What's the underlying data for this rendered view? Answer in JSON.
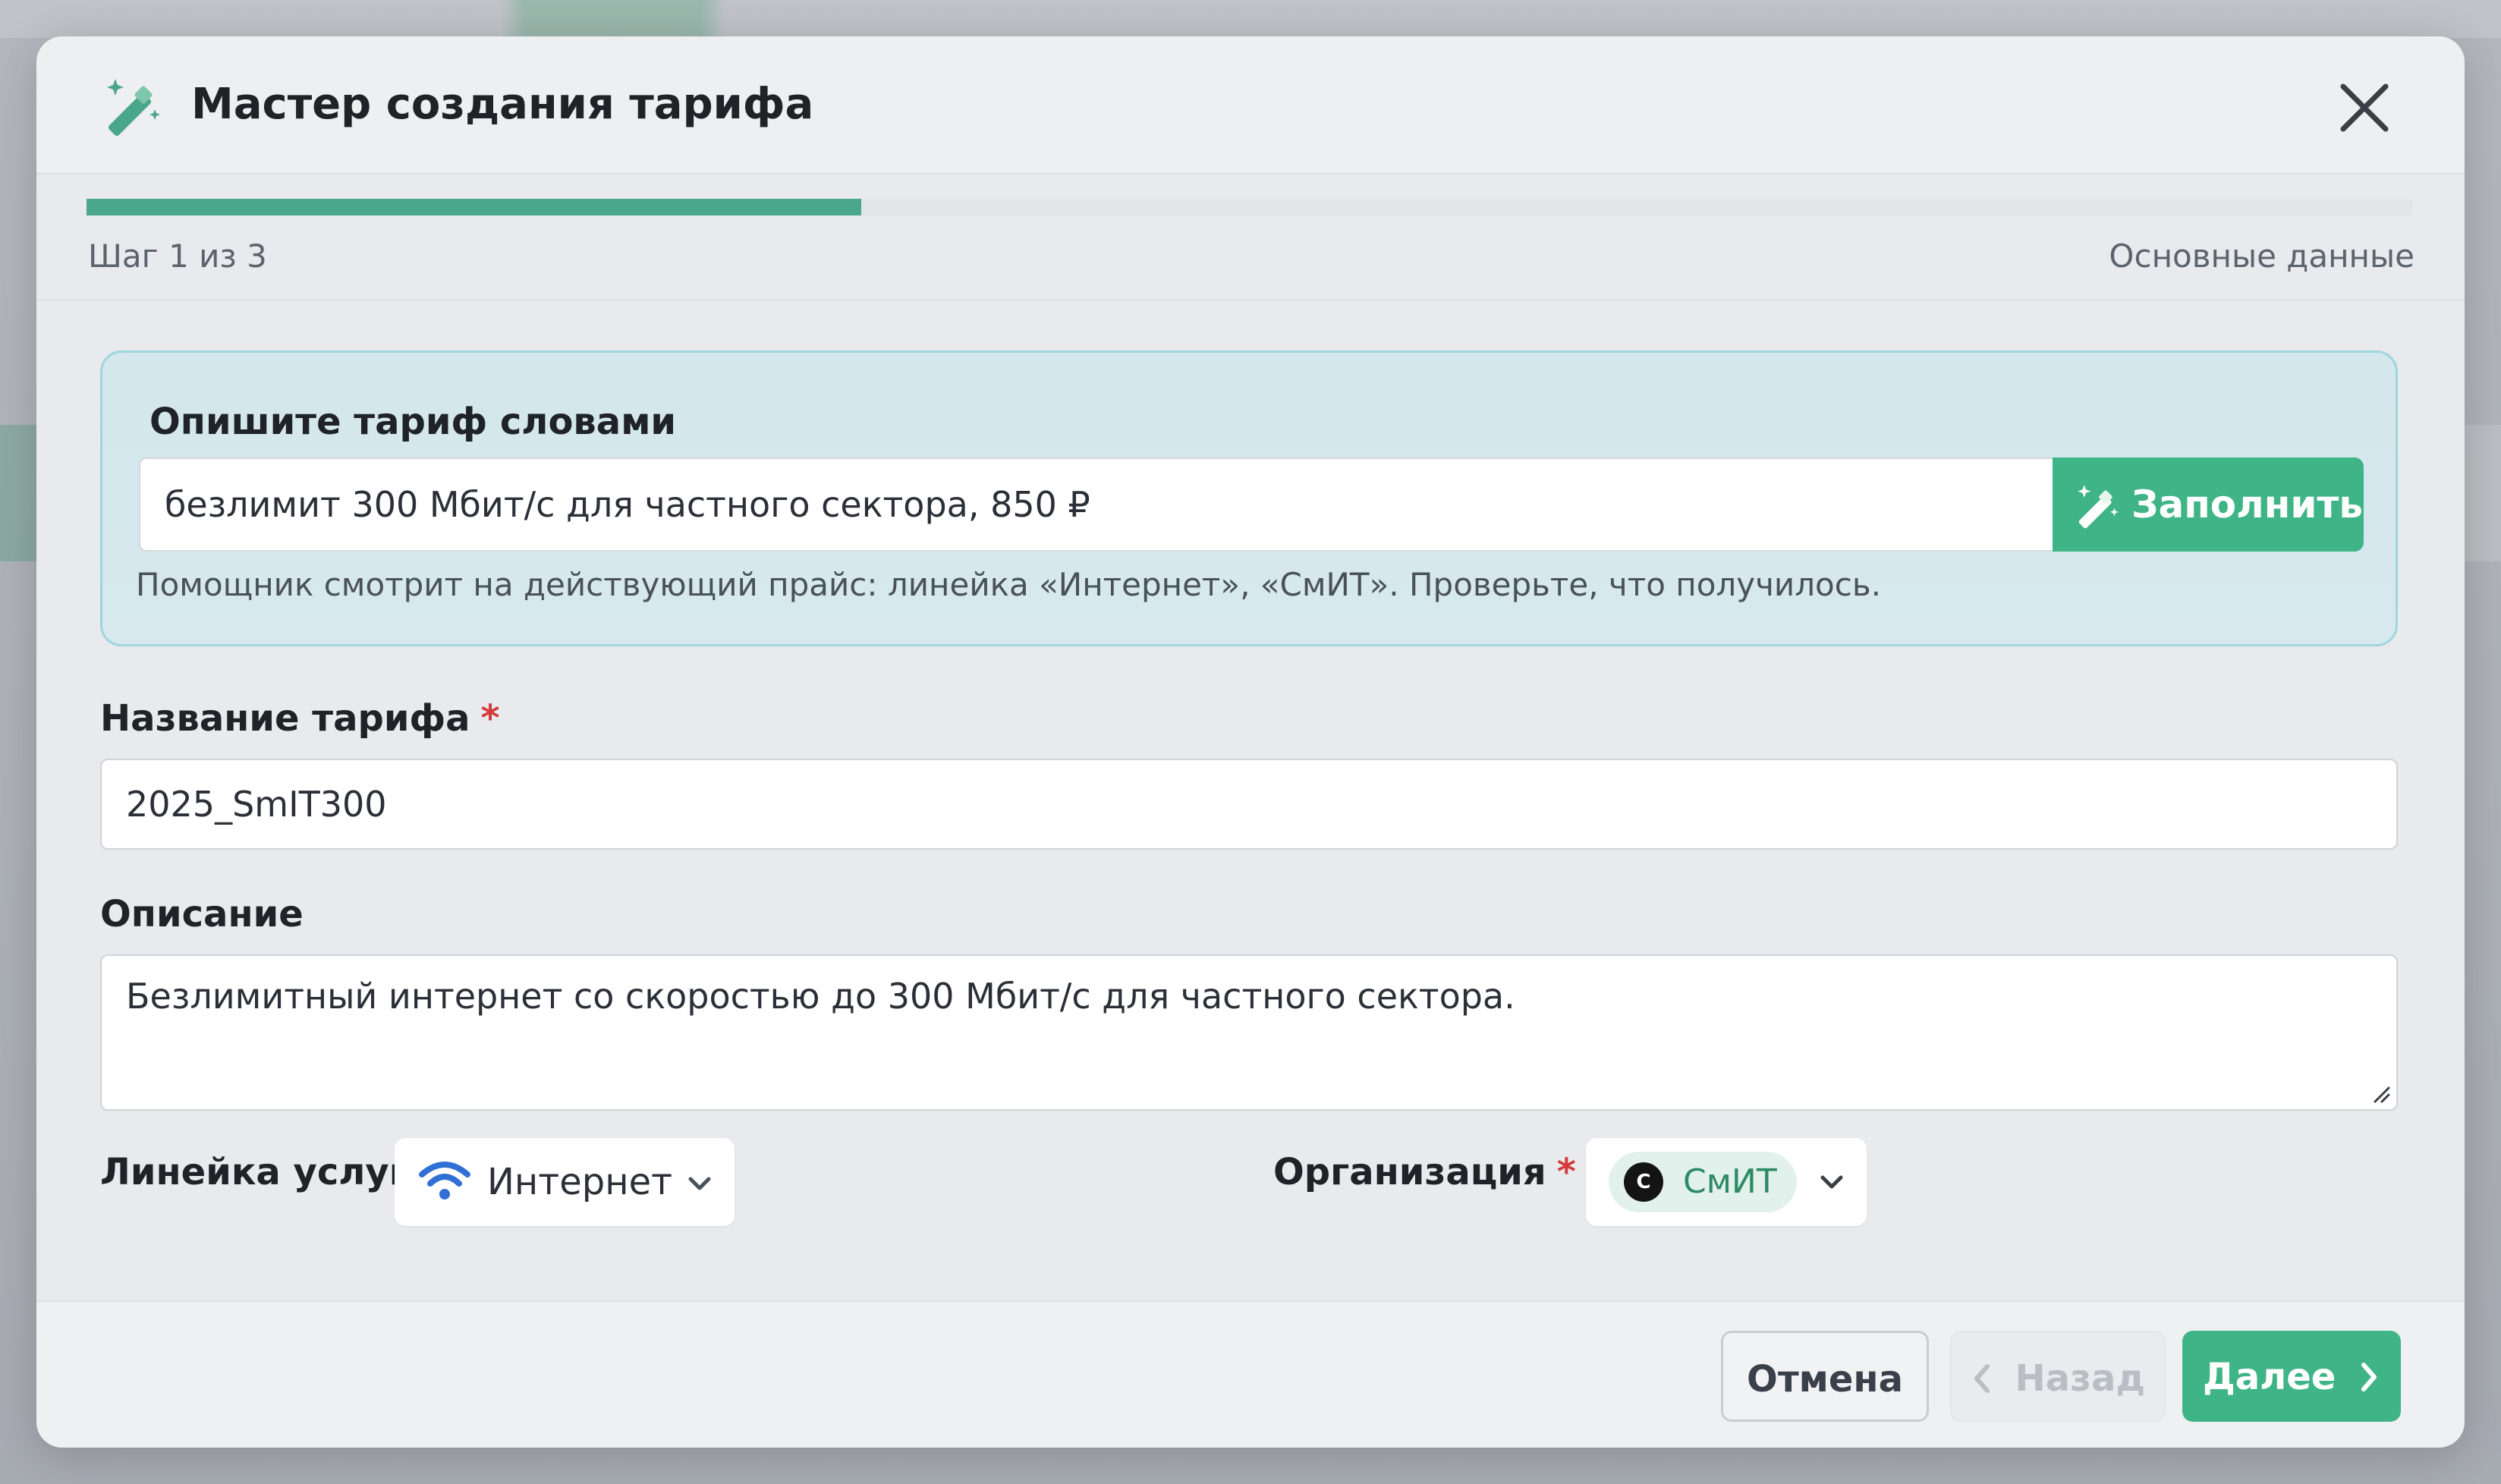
{
  "modal": {
    "title": "Мастер создания тарифа",
    "close_icon": "close-icon",
    "header_icon": "magic-wand-icon"
  },
  "progress": {
    "fraction": 0.333,
    "step_text": "Шаг 1 из 3",
    "step_name": "Основные данные"
  },
  "ai_assistant": {
    "title": "Опишите тариф словами",
    "input_value": "безлимит 300 Мбит/с для частного сектора, 850 ₽",
    "fill_button_label": "Заполнить",
    "fill_button_icon": "magic-wand-icon",
    "hint": "Помощник смотрит на действующий прайс: линейка «Интернет», «СмИТ». Проверьте, что получилось."
  },
  "fields": {
    "tariff_name": {
      "label": "Название тарифа",
      "required_mark": "*",
      "value": "2025_SmIT300"
    },
    "description": {
      "label": "Описание",
      "value": "Безлимитный интернет со скоростью до 300 Мбит/с для частного сектора."
    },
    "service_line": {
      "label": "Линейка услуг",
      "value": "Интернет",
      "icon": "wifi-icon"
    },
    "organization": {
      "label": "Организация",
      "required_mark": "*",
      "value": "СмИТ",
      "avatar_letter": "С"
    }
  },
  "footer": {
    "cancel_label": "Отмена",
    "back_label": "Назад",
    "next_label": "Далее"
  },
  "colors": {
    "accent": "#3fb487",
    "progress": "#4aa78a",
    "required": "#d33a3a",
    "wifi": "#2f6fd6"
  }
}
